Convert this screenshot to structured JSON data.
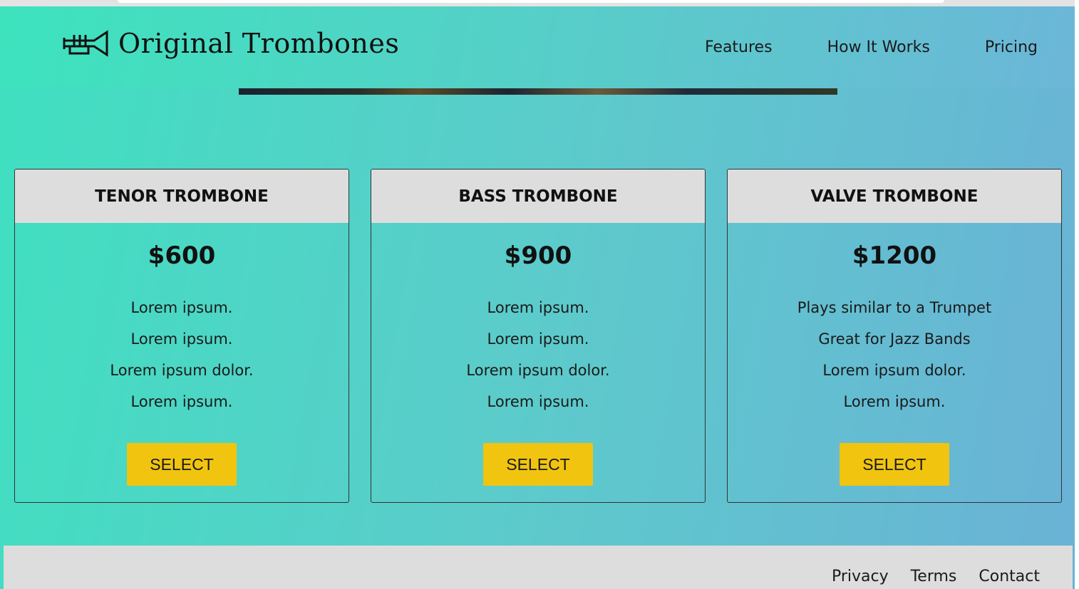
{
  "brand": {
    "name": "Original Trombones",
    "logo_icon": "trumpet-icon"
  },
  "nav": {
    "items": [
      {
        "label": "Features"
      },
      {
        "label": "How It Works"
      },
      {
        "label": "Pricing"
      }
    ]
  },
  "pricing": {
    "cards": [
      {
        "title": "TENOR TROMBONE",
        "price": "$600",
        "features": [
          "Lorem ipsum.",
          "Lorem ipsum.",
          "Lorem ipsum dolor.",
          "Lorem ipsum."
        ],
        "button_label": "SELECT"
      },
      {
        "title": "BASS TROMBONE",
        "price": "$900",
        "features": [
          "Lorem ipsum.",
          "Lorem ipsum.",
          "Lorem ipsum dolor.",
          "Lorem ipsum."
        ],
        "button_label": "SELECT"
      },
      {
        "title": "VALVE TROMBONE",
        "price": "$1200",
        "features": [
          "Plays similar to a Trumpet",
          "Great for Jazz Bands",
          "Lorem ipsum dolor.",
          "Lorem ipsum."
        ],
        "button_label": "SELECT"
      }
    ]
  },
  "footer": {
    "links": [
      {
        "label": "Privacy"
      },
      {
        "label": "Terms"
      },
      {
        "label": "Contact"
      }
    ]
  },
  "colors": {
    "gradient_start": "#3fe0c0",
    "gradient_end": "#6ab2d6",
    "card_header": "#dddddd",
    "button": "#f1c40f",
    "footer": "#dddddd"
  }
}
